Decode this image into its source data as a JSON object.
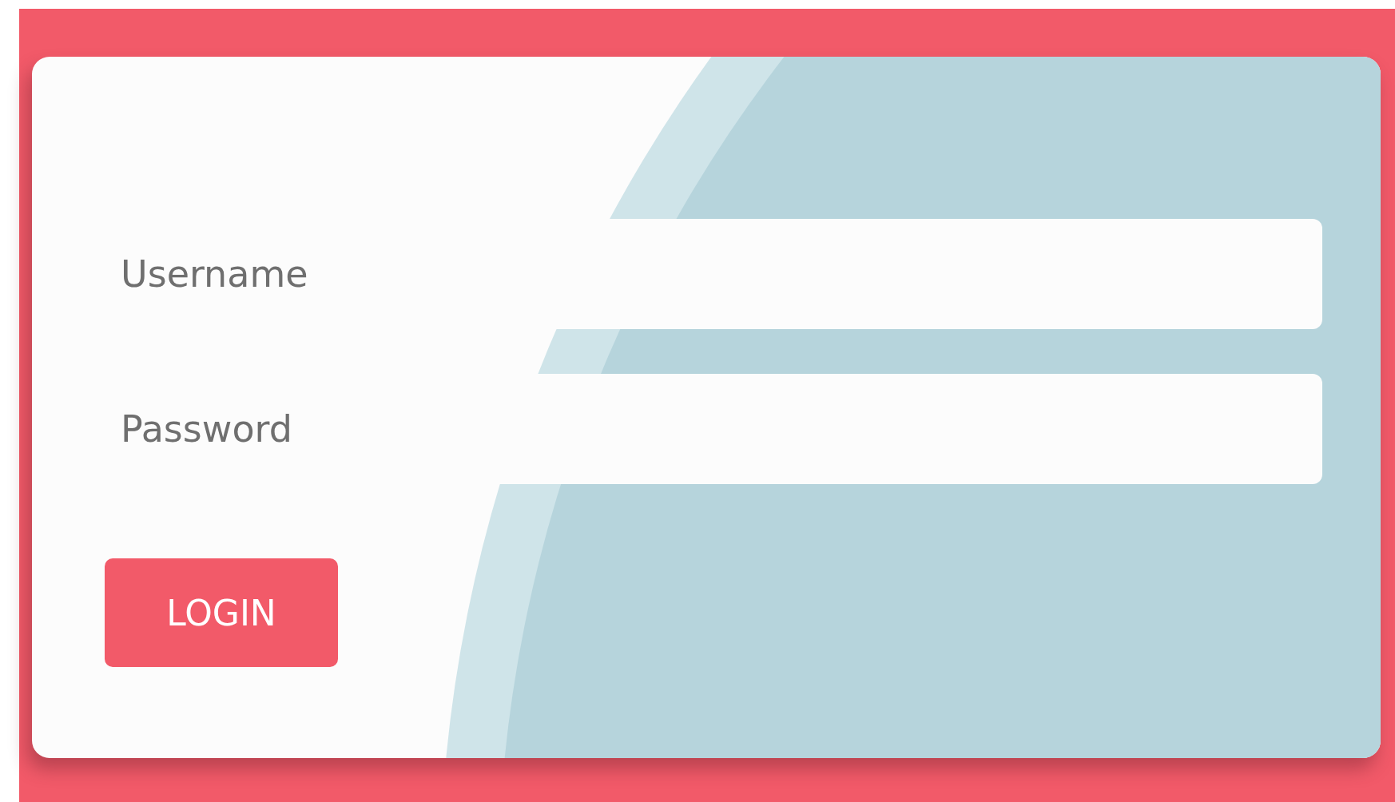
{
  "login_form": {
    "fields": [
      {
        "placeholder": "Username"
      },
      {
        "placeholder": "Password"
      }
    ],
    "button": "LOGIN"
  }
}
